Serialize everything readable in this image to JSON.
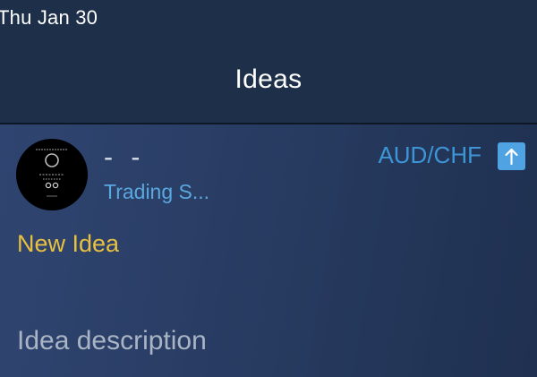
{
  "status_bar": {
    "time": "Thu Jan 30"
  },
  "nav": {
    "title": "Ideas"
  },
  "idea": {
    "author_name": "- -",
    "author_subtitle": "Trading S...",
    "symbol": "AUD/CHF",
    "direction_icon": "arrow-up-icon",
    "title_placeholder": "New Idea",
    "description_placeholder": "Idea description"
  },
  "colors": {
    "nav_background": "#1e3049",
    "content_background": "#2a3e66",
    "accent_blue": "#3d95d6",
    "badge_blue": "#4fa3e3",
    "title_yellow": "#e8c040",
    "placeholder_gray": "#a9b4c4"
  }
}
